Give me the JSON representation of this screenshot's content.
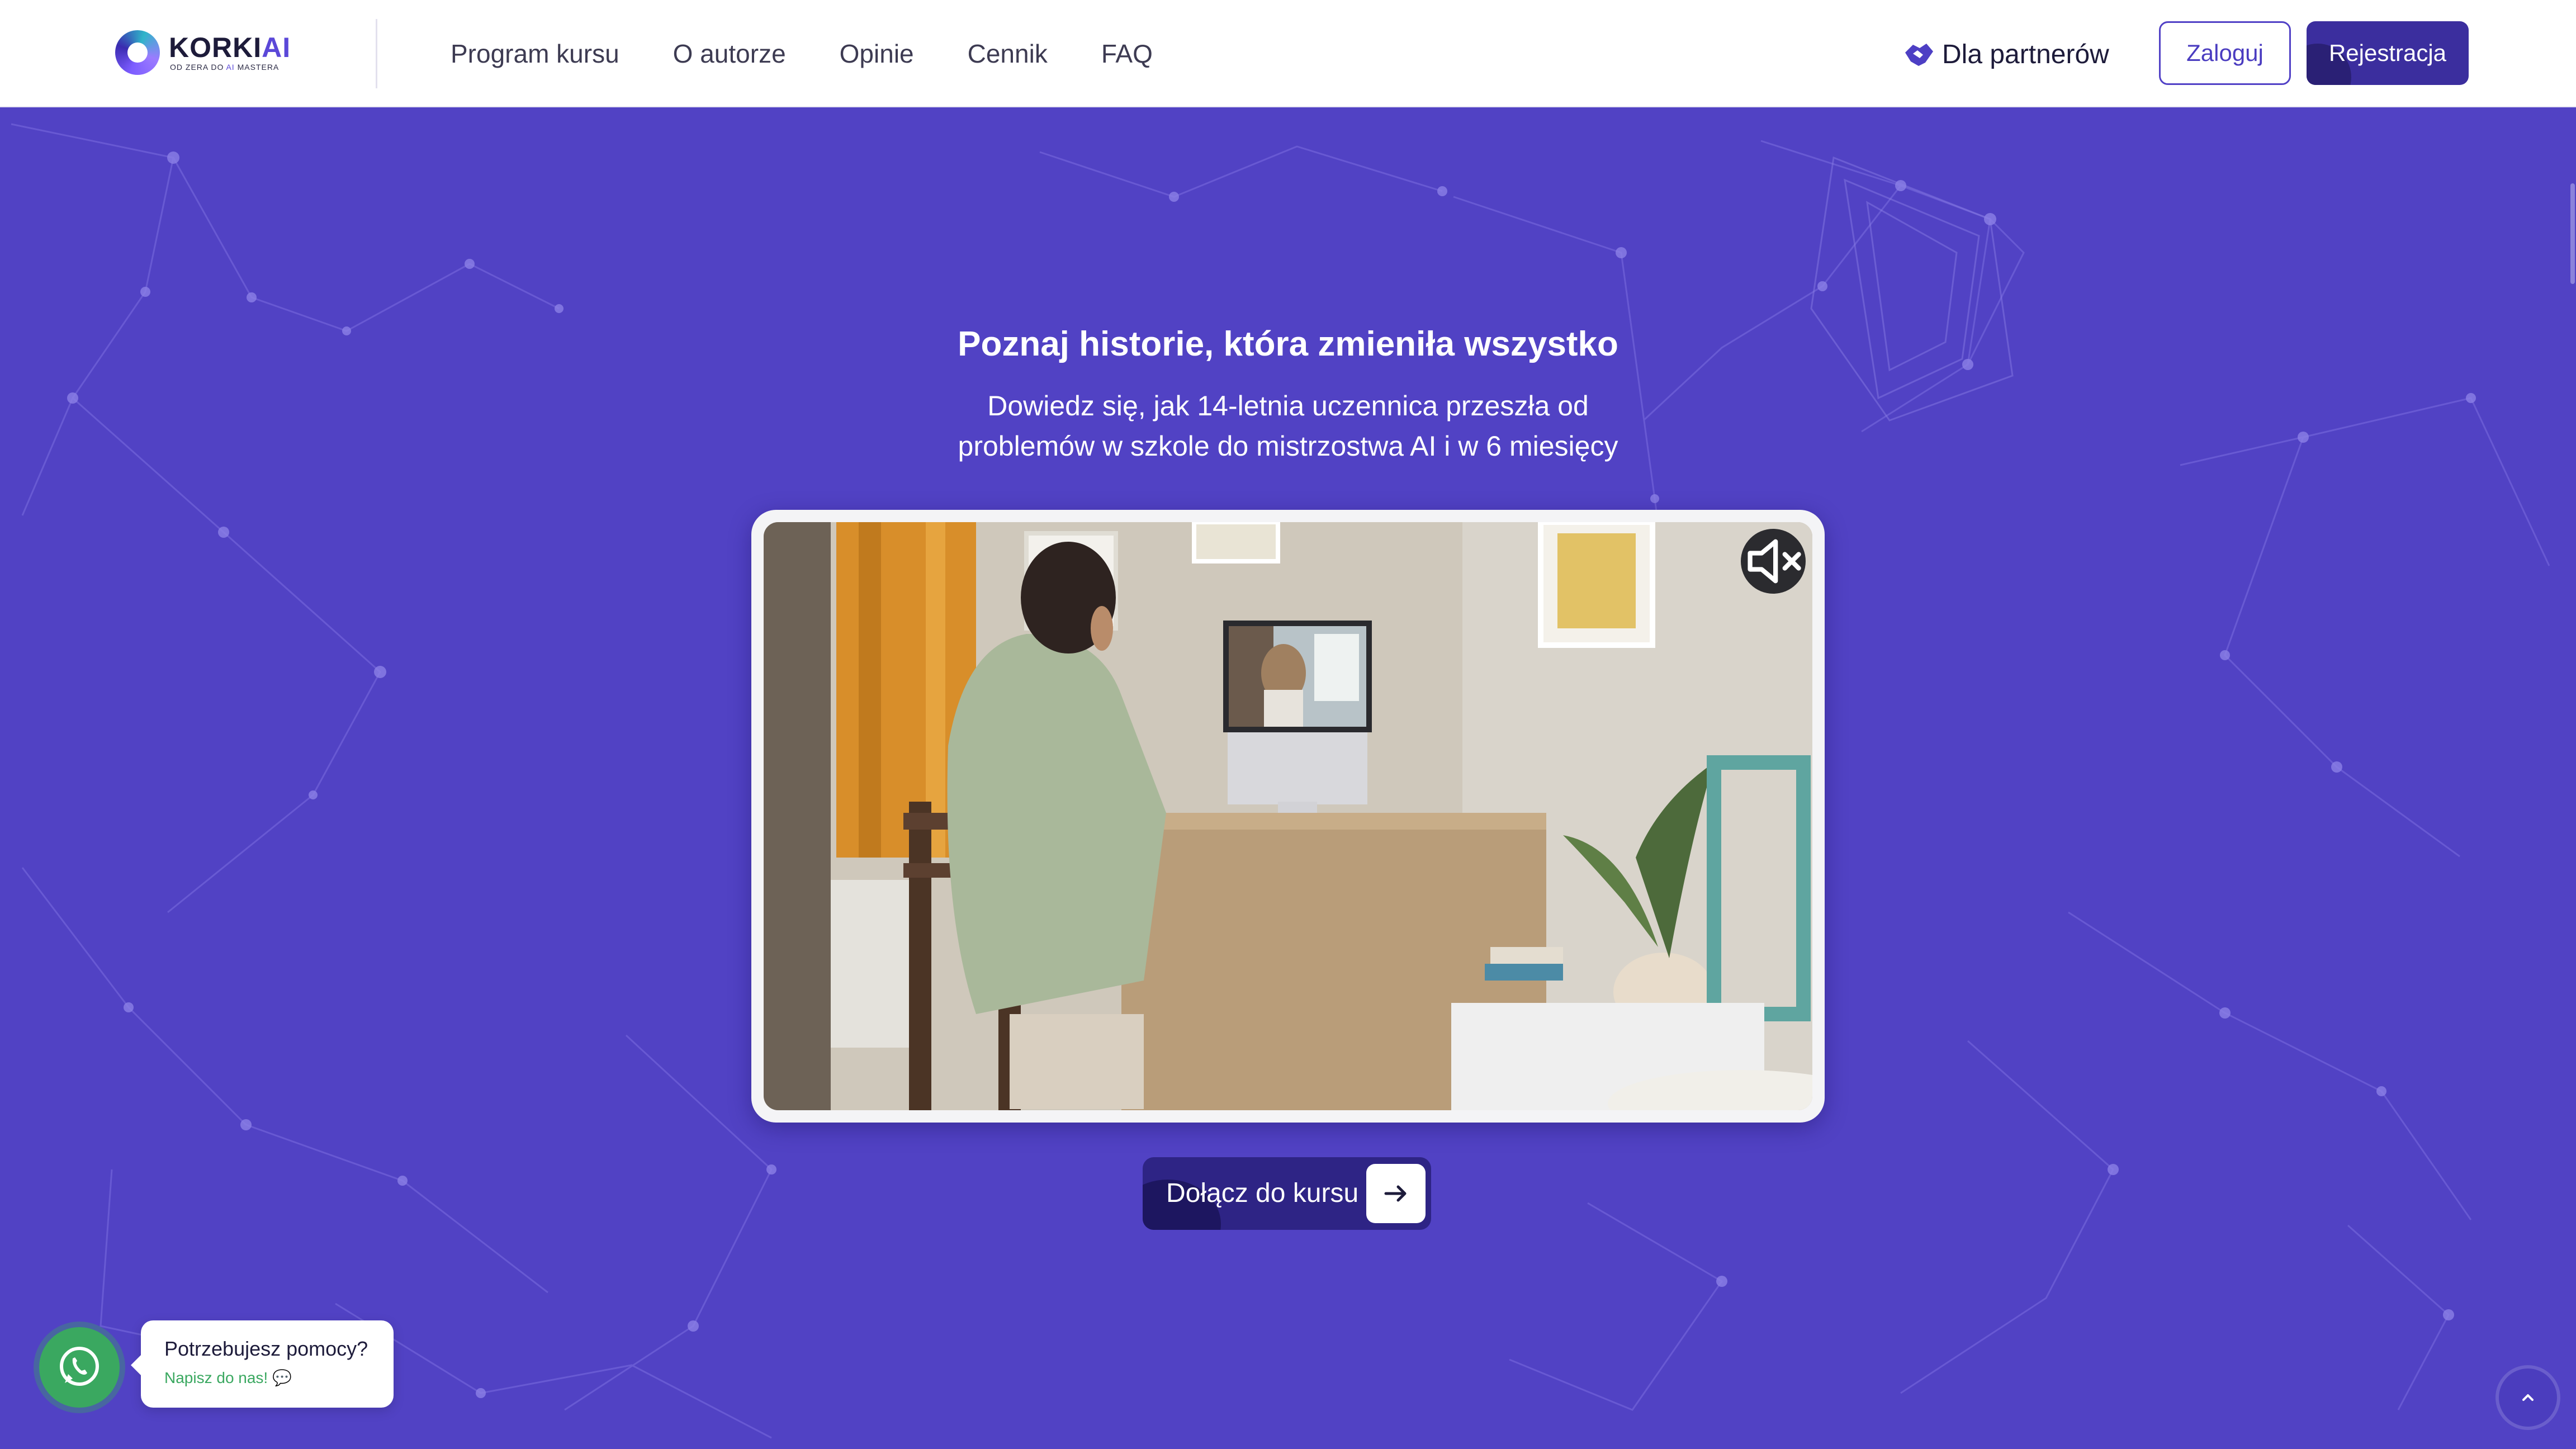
{
  "header": {
    "logo": {
      "name_main": "KORKI",
      "name_accent": "AI",
      "tagline_prefix": "OD ZERA DO ",
      "tagline_accent": "AI",
      "tagline_suffix": " MASTERA"
    },
    "nav": [
      "Program kursu",
      "O autorze",
      "Opinie",
      "Cennik",
      "FAQ"
    ],
    "partners_label": "Dla partnerów",
    "partners_icon": "handshake-icon",
    "login_label": "Zaloguj",
    "register_label": "Rejestracja"
  },
  "hero": {
    "title": "Poznaj historie, która zmieniła wszystko",
    "subtitle_line1": "Dowiedz się, jak 14-letnia uczennica przeszła od",
    "subtitle_line2": "problemów w szkole do mistrzostwa AI i w 6 miesięcy",
    "video": {
      "mute_icon": "volume-mute-icon"
    },
    "cta_label": "Dołącz do kursu",
    "cta_icon": "arrow-right-icon"
  },
  "help": {
    "icon": "whatsapp-icon",
    "title": "Potrzebujesz pomocy?",
    "subtitle": "Napisz do nas! 💬"
  },
  "scroll_top_icon": "chevron-up-icon",
  "colors": {
    "background": "#5142c4",
    "header_bg": "#ffffff",
    "brand_dark": "#3b2e9e",
    "accent": "#5b48d8",
    "help_green": "#3aa860"
  }
}
